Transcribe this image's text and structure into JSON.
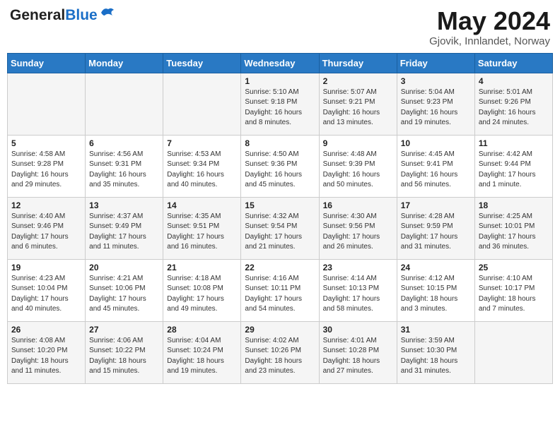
{
  "header": {
    "logo_general": "General",
    "logo_blue": "Blue",
    "month_title": "May 2024",
    "location": "Gjovik, Innlandet, Norway"
  },
  "weekdays": [
    "Sunday",
    "Monday",
    "Tuesday",
    "Wednesday",
    "Thursday",
    "Friday",
    "Saturday"
  ],
  "weeks": [
    [
      {
        "day": "",
        "info": ""
      },
      {
        "day": "",
        "info": ""
      },
      {
        "day": "",
        "info": ""
      },
      {
        "day": "1",
        "info": "Sunrise: 5:10 AM\nSunset: 9:18 PM\nDaylight: 16 hours\nand 8 minutes."
      },
      {
        "day": "2",
        "info": "Sunrise: 5:07 AM\nSunset: 9:21 PM\nDaylight: 16 hours\nand 13 minutes."
      },
      {
        "day": "3",
        "info": "Sunrise: 5:04 AM\nSunset: 9:23 PM\nDaylight: 16 hours\nand 19 minutes."
      },
      {
        "day": "4",
        "info": "Sunrise: 5:01 AM\nSunset: 9:26 PM\nDaylight: 16 hours\nand 24 minutes."
      }
    ],
    [
      {
        "day": "5",
        "info": "Sunrise: 4:58 AM\nSunset: 9:28 PM\nDaylight: 16 hours\nand 29 minutes."
      },
      {
        "day": "6",
        "info": "Sunrise: 4:56 AM\nSunset: 9:31 PM\nDaylight: 16 hours\nand 35 minutes."
      },
      {
        "day": "7",
        "info": "Sunrise: 4:53 AM\nSunset: 9:34 PM\nDaylight: 16 hours\nand 40 minutes."
      },
      {
        "day": "8",
        "info": "Sunrise: 4:50 AM\nSunset: 9:36 PM\nDaylight: 16 hours\nand 45 minutes."
      },
      {
        "day": "9",
        "info": "Sunrise: 4:48 AM\nSunset: 9:39 PM\nDaylight: 16 hours\nand 50 minutes."
      },
      {
        "day": "10",
        "info": "Sunrise: 4:45 AM\nSunset: 9:41 PM\nDaylight: 16 hours\nand 56 minutes."
      },
      {
        "day": "11",
        "info": "Sunrise: 4:42 AM\nSunset: 9:44 PM\nDaylight: 17 hours\nand 1 minute."
      }
    ],
    [
      {
        "day": "12",
        "info": "Sunrise: 4:40 AM\nSunset: 9:46 PM\nDaylight: 17 hours\nand 6 minutes."
      },
      {
        "day": "13",
        "info": "Sunrise: 4:37 AM\nSunset: 9:49 PM\nDaylight: 17 hours\nand 11 minutes."
      },
      {
        "day": "14",
        "info": "Sunrise: 4:35 AM\nSunset: 9:51 PM\nDaylight: 17 hours\nand 16 minutes."
      },
      {
        "day": "15",
        "info": "Sunrise: 4:32 AM\nSunset: 9:54 PM\nDaylight: 17 hours\nand 21 minutes."
      },
      {
        "day": "16",
        "info": "Sunrise: 4:30 AM\nSunset: 9:56 PM\nDaylight: 17 hours\nand 26 minutes."
      },
      {
        "day": "17",
        "info": "Sunrise: 4:28 AM\nSunset: 9:59 PM\nDaylight: 17 hours\nand 31 minutes."
      },
      {
        "day": "18",
        "info": "Sunrise: 4:25 AM\nSunset: 10:01 PM\nDaylight: 17 hours\nand 36 minutes."
      }
    ],
    [
      {
        "day": "19",
        "info": "Sunrise: 4:23 AM\nSunset: 10:04 PM\nDaylight: 17 hours\nand 40 minutes."
      },
      {
        "day": "20",
        "info": "Sunrise: 4:21 AM\nSunset: 10:06 PM\nDaylight: 17 hours\nand 45 minutes."
      },
      {
        "day": "21",
        "info": "Sunrise: 4:18 AM\nSunset: 10:08 PM\nDaylight: 17 hours\nand 49 minutes."
      },
      {
        "day": "22",
        "info": "Sunrise: 4:16 AM\nSunset: 10:11 PM\nDaylight: 17 hours\nand 54 minutes."
      },
      {
        "day": "23",
        "info": "Sunrise: 4:14 AM\nSunset: 10:13 PM\nDaylight: 17 hours\nand 58 minutes."
      },
      {
        "day": "24",
        "info": "Sunrise: 4:12 AM\nSunset: 10:15 PM\nDaylight: 18 hours\nand 3 minutes."
      },
      {
        "day": "25",
        "info": "Sunrise: 4:10 AM\nSunset: 10:17 PM\nDaylight: 18 hours\nand 7 minutes."
      }
    ],
    [
      {
        "day": "26",
        "info": "Sunrise: 4:08 AM\nSunset: 10:20 PM\nDaylight: 18 hours\nand 11 minutes."
      },
      {
        "day": "27",
        "info": "Sunrise: 4:06 AM\nSunset: 10:22 PM\nDaylight: 18 hours\nand 15 minutes."
      },
      {
        "day": "28",
        "info": "Sunrise: 4:04 AM\nSunset: 10:24 PM\nDaylight: 18 hours\nand 19 minutes."
      },
      {
        "day": "29",
        "info": "Sunrise: 4:02 AM\nSunset: 10:26 PM\nDaylight: 18 hours\nand 23 minutes."
      },
      {
        "day": "30",
        "info": "Sunrise: 4:01 AM\nSunset: 10:28 PM\nDaylight: 18 hours\nand 27 minutes."
      },
      {
        "day": "31",
        "info": "Sunrise: 3:59 AM\nSunset: 10:30 PM\nDaylight: 18 hours\nand 31 minutes."
      },
      {
        "day": "",
        "info": ""
      }
    ]
  ]
}
